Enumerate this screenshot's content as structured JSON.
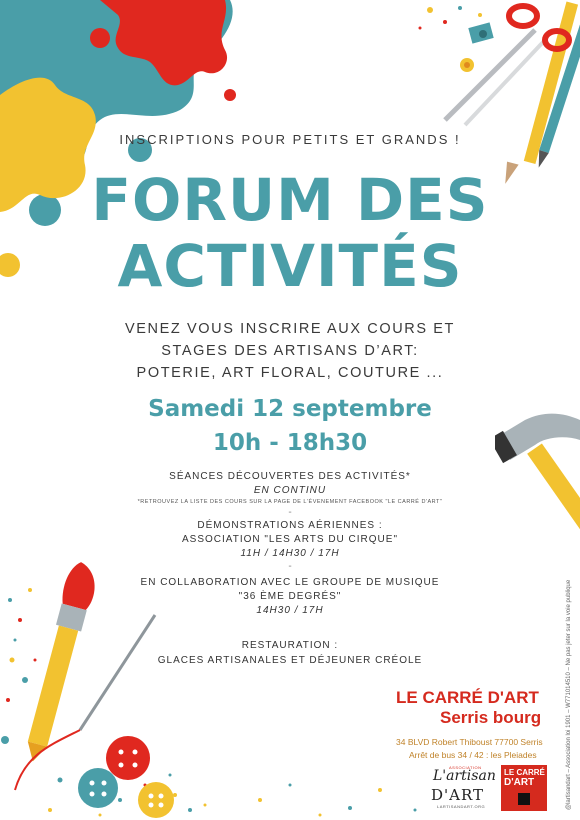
{
  "header": {
    "tagline": "INSCRIPTIONS POUR PETITS ET GRANDS !",
    "title_line1": "FORUM DES",
    "title_line2": "ACTIVITÉS"
  },
  "intro": {
    "line1": "VENEZ VOUS INSCRIRE AUX COURS ET",
    "line2": "STAGES DES ARTISANS D’ART:",
    "line3": "POTERIE, ART FLORAL, COUTURE ..."
  },
  "event": {
    "date": "Samedi 12 septembre",
    "hours": "10h - 18h30"
  },
  "program": {
    "block1_title": "SÉANCES DÉCOUVERTES DES ACTIVITÉS*",
    "block1_sub": "EN CONTINU",
    "block1_note": "*RETROUVEZ LA LISTE DES COURS SUR LA PAGE DE L'ÉVENEMENT FACEBOOK \"LE CARRÉ D'ART\"",
    "separator": "-",
    "block2_title": "DÉMONSTRATIONS AÉRIENNES :",
    "block2_line2": "ASSOCIATION \"LES ARTS DU CIRQUE\"",
    "block2_times": "11H / 14H30 / 17H",
    "block3_title": "EN COLLABORATION AVEC LE GROUPE DE MUSIQUE",
    "block3_line2": "\"36 ÈME DEGRÉS\"",
    "block3_times": "14H30 / 17H",
    "block4_title": "RESTAURATION :",
    "block4_line2": "GLACES ARTISANALES ET DÉJEUNER CRÉOLE"
  },
  "venue": {
    "name": "LE CARRÉ D'ART",
    "place": "Serris bourg",
    "address": "34 BLVD Robert Thiboust 77700 Serris",
    "bus": "Arrêt de bus 34 / 42 : les Pleiades"
  },
  "logos": {
    "artisan_small": "ASSOCIATION",
    "artisan_script": "L'artisan",
    "artisan_main": "D'ART",
    "artisan_url": "LARTISANDART.ORG",
    "carre_line1": "LE CARRÉ",
    "carre_line2": "D'ART"
  },
  "legal": {
    "vertical_text": "@lartisandart – Association loi 1901 – W771014510 – Ne pas jeter sur la voie publique"
  },
  "colors": {
    "teal": "#4a9ea8",
    "red": "#d52a1e",
    "yellow": "#f2c230",
    "text": "#3a3a3a"
  }
}
